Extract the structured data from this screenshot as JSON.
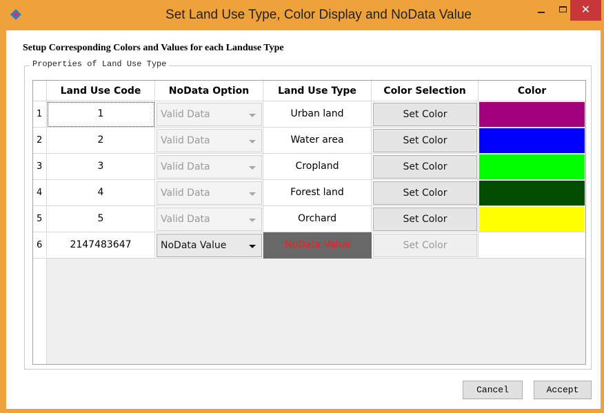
{
  "window": {
    "title": "Set Land Use Type, Color Display and NoData Value",
    "app_icon": "app-diamond-icon",
    "minimize_icon": "minimize-icon",
    "maximize_icon": "maximize-icon",
    "close_icon": "close-icon",
    "close_glyph": "✕",
    "titlebar_color": "#f0a23a"
  },
  "heading": "Setup Corresponding Colors and Values for each Landuse Type",
  "groupbox_label": "Properties of Land Use Type",
  "table": {
    "columns": [
      "Land Use Code",
      "NoData Option",
      "Land Use Type",
      "Color Selection",
      "Color"
    ],
    "rows": [
      {
        "num": "1",
        "code": "1",
        "option": "Valid Data",
        "type": "Urban land",
        "button": "Set Color",
        "color": "#a0007a",
        "option_enabled": false,
        "button_enabled": true
      },
      {
        "num": "2",
        "code": "2",
        "option": "Valid Data",
        "type": "Water area",
        "button": "Set Color",
        "color": "#0000ff",
        "option_enabled": false,
        "button_enabled": true
      },
      {
        "num": "3",
        "code": "3",
        "option": "Valid Data",
        "type": "Cropland",
        "button": "Set Color",
        "color": "#00ff00",
        "option_enabled": false,
        "button_enabled": true
      },
      {
        "num": "4",
        "code": "4",
        "option": "Valid Data",
        "type": "Forest land",
        "button": "Set Color",
        "color": "#004d00",
        "option_enabled": false,
        "button_enabled": true
      },
      {
        "num": "5",
        "code": "5",
        "option": "Valid Data",
        "type": "Orchard",
        "button": "Set Color",
        "color": "#ffff00",
        "option_enabled": false,
        "button_enabled": true
      },
      {
        "num": "6",
        "code": "2147483647",
        "option": "NoData Value",
        "type": "NoData Value",
        "button": "Set Color",
        "color": "#ffffff",
        "option_enabled": true,
        "button_enabled": false
      }
    ]
  },
  "buttons": {
    "cancel": "Cancel",
    "accept": "Accept"
  }
}
